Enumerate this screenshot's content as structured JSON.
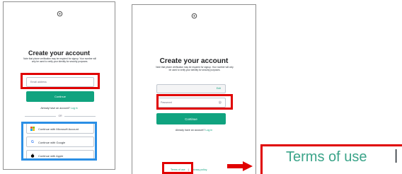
{
  "left_form": {
    "title": "Create your account",
    "subtitle": "Note that phone verification may be required for signup. Your number will only be used to verify your identity for security purposes.",
    "email_placeholder": "Email address",
    "continue_label": "Continue",
    "login_prompt": "Already have an account?",
    "login_link": "Log in",
    "or_label": "OR",
    "social_buttons": [
      {
        "icon": "microsoft-icon",
        "label": "Continue with Microsoft Account"
      },
      {
        "icon": "google-icon",
        "label": "Continue with Google"
      },
      {
        "icon": "apple-icon",
        "label": "Continue with Apple"
      }
    ]
  },
  "right_form": {
    "title": "Create your account",
    "subtitle": "Note that phone verification may be required for signup. Your number will only be used to verify your identity for security purposes.",
    "edit_label": "Edit",
    "password_placeholder": "Password",
    "continue_label": "Continue",
    "login_prompt": "Already have an account?",
    "login_link": "Log in",
    "terms_label": "Terms of use",
    "privacy_label": "Privacy policy"
  },
  "zoom": {
    "terms_label": "Terms of use",
    "separator": "|"
  },
  "colors": {
    "accent": "#10a37f",
    "highlight_red": "#e00000",
    "highlight_blue": "#2b8fe5"
  }
}
